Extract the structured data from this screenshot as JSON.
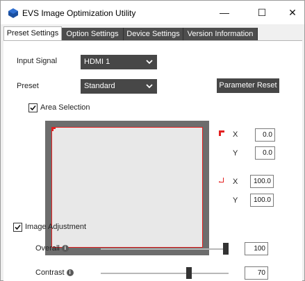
{
  "window": {
    "title": "EVS Image Optimization Utility",
    "controls": {
      "minimize": "—",
      "maximize": "☐",
      "close": "✕"
    }
  },
  "tabs": [
    {
      "label": "Preset Settings",
      "active": true
    },
    {
      "label": "Option Settings",
      "active": false
    },
    {
      "label": "Device Settings",
      "active": false
    },
    {
      "label": "Version Information",
      "active": false
    }
  ],
  "input_signal": {
    "label": "Input Signal",
    "value": "HDMI 1"
  },
  "preset": {
    "label": "Preset",
    "value": "Standard"
  },
  "parameter_reset": {
    "label": "Parameter Reset"
  },
  "area_selection": {
    "label": "Area Selection",
    "checked": true,
    "top_left": {
      "x_label": "X",
      "y_label": "Y",
      "x": "0.0",
      "y": "0.0"
    },
    "bottom_right": {
      "x_label": "X",
      "y_label": "Y",
      "x": "100.0",
      "y": "100.0"
    }
  },
  "image_adjustment": {
    "label": "Image Adjustment",
    "checked": true,
    "sliders": [
      {
        "label": "Overall",
        "value": "100",
        "max": 100
      },
      {
        "label": "Contrast",
        "value": "70",
        "max": 100
      }
    ]
  },
  "colors": {
    "dark_control": "#474747",
    "accent_red": "#e32020",
    "app_icon_blue": "#1a4fa0"
  },
  "icons": {
    "app": "app-icon",
    "chevron": "chevron-down-icon",
    "info": "info-icon",
    "check": "check-icon"
  }
}
